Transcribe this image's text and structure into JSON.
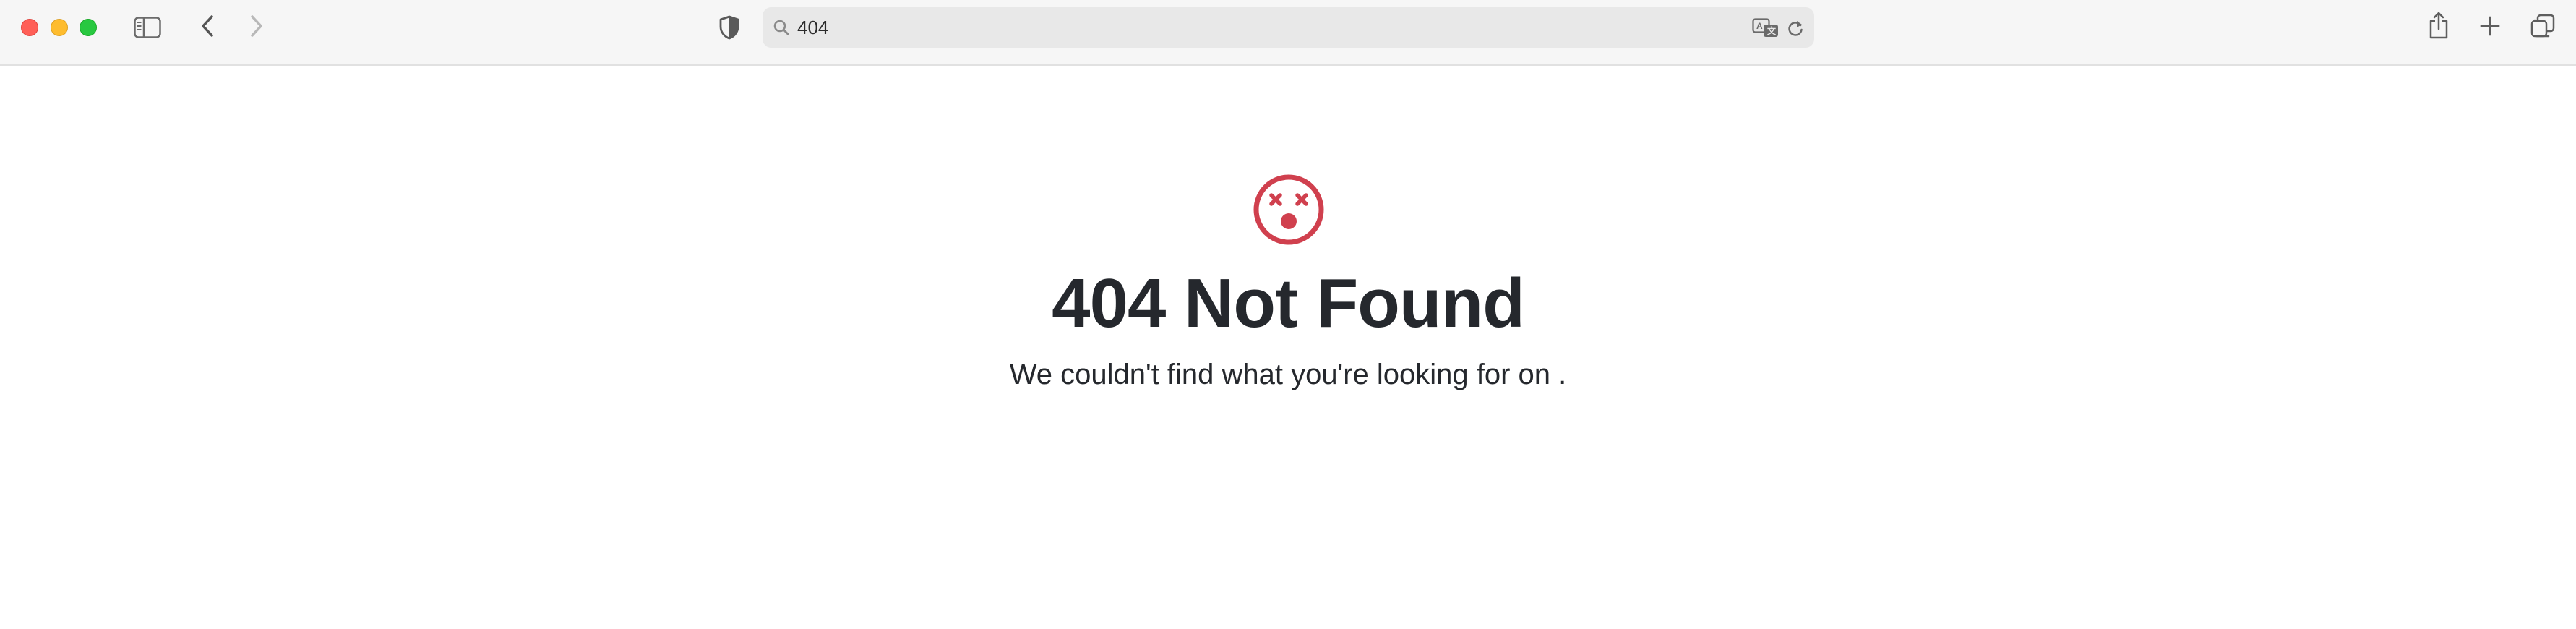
{
  "browser": {
    "address_bar": {
      "url": "404"
    },
    "icons": {
      "sidebar": "sidebar-icon",
      "back": "chevron-left-icon",
      "forward": "chevron-right-icon",
      "privacy": "shield-icon",
      "search": "search-icon",
      "translate": "translate-icon",
      "reload": "reload-icon",
      "share": "share-icon",
      "new_tab": "plus-icon",
      "tabs_overview": "tabs-icon"
    }
  },
  "page": {
    "title": "404 Not Found",
    "message": "We couldn't find what you're looking for on .",
    "icon": "dizzy-face-icon",
    "accent_color": "#d0404e",
    "text_color": "#25282d"
  }
}
